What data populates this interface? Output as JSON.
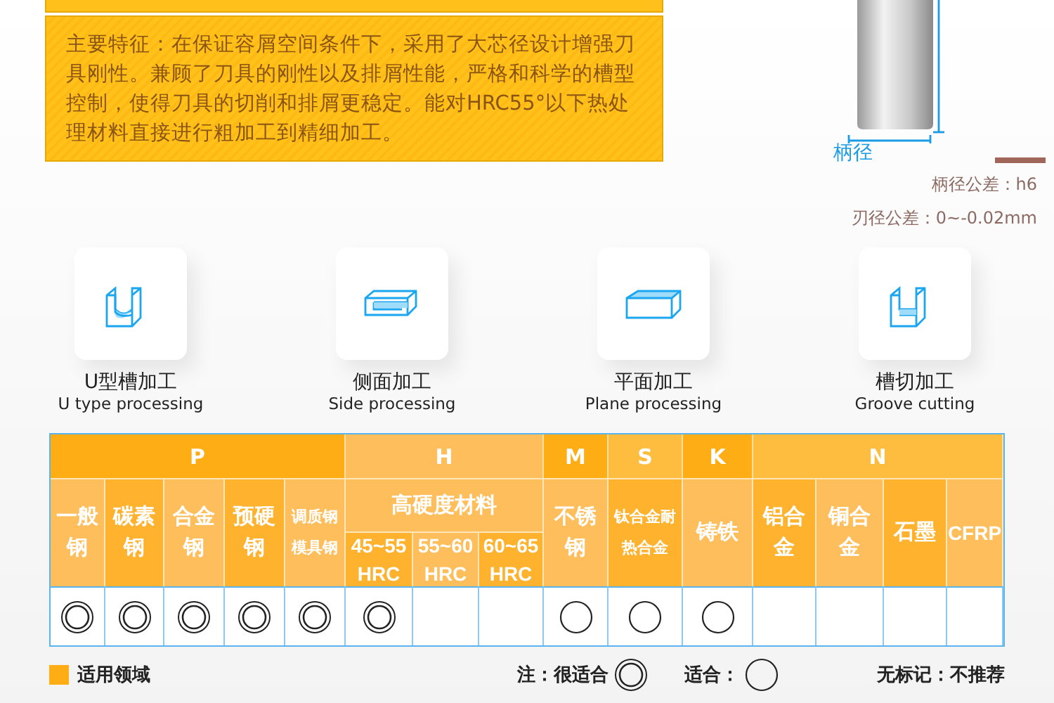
{
  "feature_box": {
    "text": "主要特征：在保证容屑空间条件下，采用了大芯径设计增强刀具刚性。兼顾了刀具的刚性以及排屑性能，严格和科学的槽型控制，使得刀具的切削和排屑更稳定。能对HRC55°以下热处理材料直接进行粗加工到精细加工。"
  },
  "tool": {
    "dimension_label": "柄径",
    "tolerances": [
      "柄径公差：h6",
      "刃径公差：0~-0.02mm"
    ]
  },
  "processes": [
    {
      "kind": "u-groove",
      "title": "U型槽加工",
      "subtitle": "U type processing"
    },
    {
      "kind": "side",
      "title": "侧面加工",
      "subtitle": "Side processing"
    },
    {
      "kind": "plane",
      "title": "平面加工",
      "subtitle": "Plane processing"
    },
    {
      "kind": "groove",
      "title": "槽切加工",
      "subtitle": "Groove cutting"
    }
  ],
  "table": {
    "groups": [
      {
        "label": "P",
        "color": "#ffad14",
        "columns": [
          {
            "label": "一般钢",
            "kind": "double"
          },
          {
            "label": "碳素钢",
            "kind": "double"
          },
          {
            "label": "合金钢",
            "kind": "double"
          },
          {
            "label": "预硬钢",
            "kind": "double"
          },
          {
            "label": "调质钢模具钢",
            "kind": "double"
          }
        ]
      },
      {
        "label": "H",
        "color": "#ffbe5c",
        "sub_label": "高硬度材料",
        "columns": [
          {
            "label": "45~55 HRC",
            "kind": "double"
          },
          {
            "label": "55~60 HRC",
            "kind": "empty"
          },
          {
            "label": "60~65 HRC",
            "kind": "empty"
          }
        ]
      },
      {
        "label": "M",
        "color": "#ffad14",
        "columns": [
          {
            "label": "不锈钢",
            "kind": "single"
          }
        ]
      },
      {
        "label": "S",
        "color": "#ffbd40",
        "columns": [
          {
            "label": "钛合金耐热合金",
            "kind": "single"
          }
        ]
      },
      {
        "label": "K",
        "color": "#ffad14",
        "columns": [
          {
            "label": "铸铁",
            "kind": "single"
          }
        ]
      },
      {
        "label": "N",
        "color": "#ffbd40",
        "columns": [
          {
            "label": "铝合金",
            "kind": "empty"
          },
          {
            "label": "铜合金",
            "kind": "empty"
          },
          {
            "label": "石墨",
            "kind": "empty"
          },
          {
            "label": "CFRP",
            "kind": "empty"
          }
        ]
      }
    ]
  },
  "legend": {
    "swatch_label": "适用领域",
    "note_label": "注：很适合",
    "fit_label": "适合：",
    "none_label": "无标记：不推荐"
  }
}
